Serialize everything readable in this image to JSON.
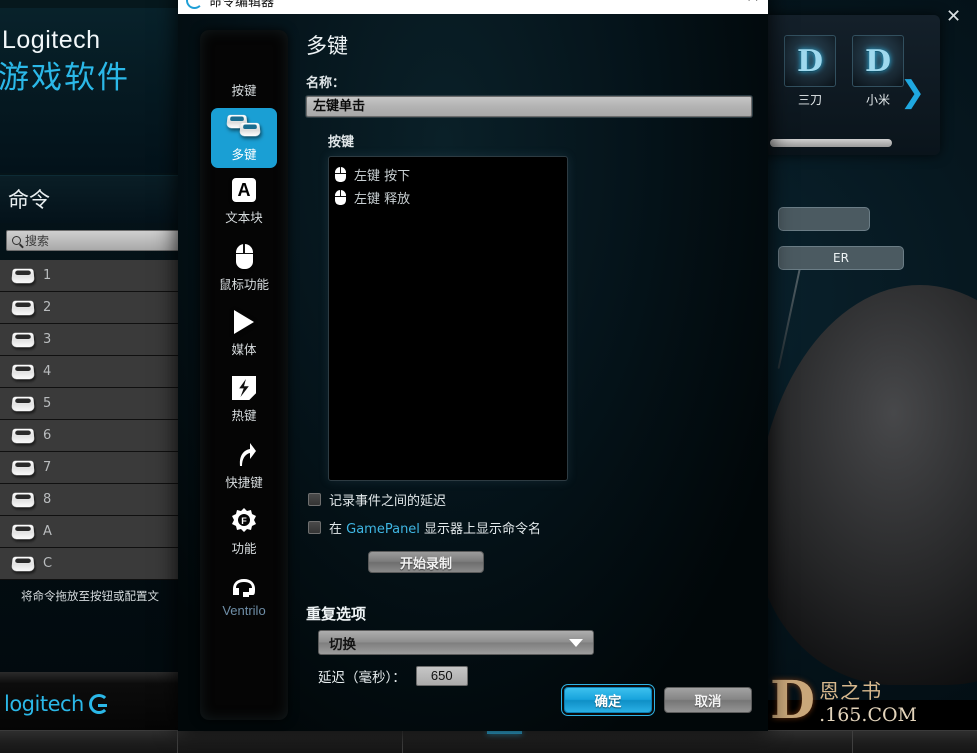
{
  "background": {
    "brand_line1": "Logitech",
    "brand_line2": "游戏软件",
    "commands_title": "命令",
    "search_placeholder": "搜索",
    "command_items": [
      {
        "label": "1"
      },
      {
        "label": "2"
      },
      {
        "label": "3"
      },
      {
        "label": "4"
      },
      {
        "label": "5"
      },
      {
        "label": "6"
      },
      {
        "label": "7"
      },
      {
        "label": "8"
      },
      {
        "label": "A"
      },
      {
        "label": "C"
      }
    ],
    "hint": "将命令拖放至按钮或配置文",
    "footer_logo": "logitech",
    "close_label": "✕",
    "profiles": [
      {
        "label": "三刀",
        "glyph": "D"
      },
      {
        "label": "小米",
        "glyph": "D"
      }
    ],
    "profile_next": "❯",
    "assign_buttons": [
      {
        "label": ""
      },
      {
        "label": "ER"
      }
    ],
    "watermark": {
      "glyph": "D",
      "cn": "恩之书",
      "com": ".165.COM"
    }
  },
  "dialog": {
    "title": "命令编辑器",
    "close_label": "✕",
    "sidebar": [
      {
        "label": "按键",
        "icon": "keycap-icon",
        "selected": false
      },
      {
        "label": "多键",
        "icon": "multikey-icon",
        "selected": true
      },
      {
        "label": "文本块",
        "icon": "textblock-icon",
        "selected": false
      },
      {
        "label": "鼠标功能",
        "icon": "mouse-icon",
        "selected": false
      },
      {
        "label": "媒体",
        "icon": "play-icon",
        "selected": false
      },
      {
        "label": "热键",
        "icon": "hotkey-icon",
        "selected": false
      },
      {
        "label": "快捷键",
        "icon": "shortcut-icon",
        "selected": false
      },
      {
        "label": "功能",
        "icon": "gear-f-icon",
        "selected": false
      },
      {
        "label": "Ventrilo",
        "icon": "headset-icon",
        "selected": false
      }
    ],
    "heading": "多键",
    "name_label": "名称：",
    "name_value": "左键单击",
    "keys_label": "按键",
    "events": [
      {
        "text": "左键 按下",
        "icon": "mouse-icon"
      },
      {
        "text": "左键 释放",
        "icon": "mouse-icon"
      }
    ],
    "checkbox_delay": "记录事件之间的延迟",
    "checkbox_gamepanel_pre": "在 ",
    "checkbox_gamepanel_brand": "GamePanel",
    "checkbox_gamepanel_post": " 显示器上显示命令名",
    "record_button": "开始录制",
    "repeat_title": "重复选项",
    "repeat_value": "切换",
    "delay_label": "延迟（毫秒）：",
    "delay_value": "650",
    "ok_button": "确定",
    "cancel_button": "取消"
  },
  "colors": {
    "accent_blue": "#1a9fd4",
    "brand_cyan": "#2bb8e8",
    "dialog_title_bg": "#ffffff"
  }
}
